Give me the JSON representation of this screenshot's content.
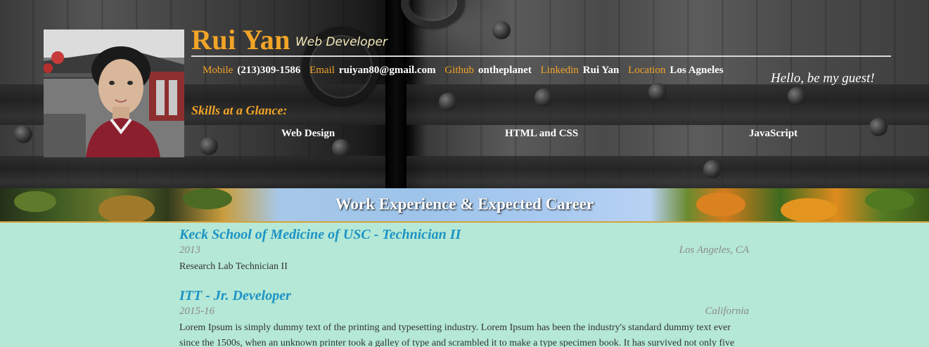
{
  "profile": {
    "name": "Rui Yan",
    "role": "Web Developer",
    "greeting": "Hello, be my guest!"
  },
  "contacts": [
    {
      "label": "Mobile",
      "value": "(213)309-1586"
    },
    {
      "label": "Email",
      "value": "ruiyan80@gmail.com"
    },
    {
      "label": "Github",
      "value": "ontheplanet"
    },
    {
      "label": "Linkedin",
      "value": "Rui Yan"
    },
    {
      "label": "Location",
      "value": "Los Agneles"
    }
  ],
  "skills": {
    "title": "Skills at a Glance:",
    "items": [
      "Web Design",
      "HTML and CSS",
      "JavaScript"
    ]
  },
  "section": {
    "title": "Work Experience & Expected Career"
  },
  "jobs": [
    {
      "title": "Keck School of Medicine of USC - Technician II",
      "date": "2013",
      "location": "Los Angeles, CA",
      "description": "Research Lab Technician II"
    },
    {
      "title": "ITT - Jr. Developer",
      "date": "2015-16",
      "location": "California",
      "description": "Lorem Ipsum is simply dummy text of the printing and typesetting industry. Lorem Ipsum has been the industry's standard dummy text ever since the 1500s, when an unknown printer took a galley of type and scrambled it to make a type specimen book. It has survived not only five"
    }
  ],
  "colors": {
    "accent": "#f2a427",
    "job_title": "#1c93c4",
    "page_background": "#b5e8d6"
  }
}
